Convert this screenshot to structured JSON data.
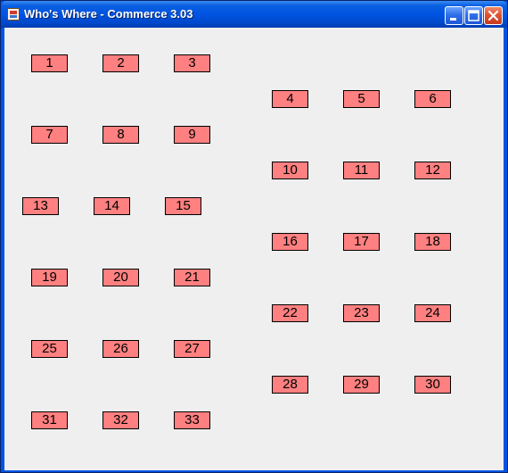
{
  "window": {
    "title": "Who's Where - Commerce 3.03"
  },
  "icons": {
    "app": "java-cup-icon",
    "minimize": "minimize-icon",
    "maximize": "maximize-icon",
    "close": "close-icon"
  },
  "colors": {
    "cell_fill": "#ff8080",
    "cell_border": "#000000",
    "client_bg": "#efefef",
    "titlebar": "#0054e3"
  },
  "cells": [
    "1",
    "2",
    "3",
    "4",
    "5",
    "6",
    "7",
    "8",
    "9",
    "10",
    "11",
    "12",
    "13",
    "14",
    "15",
    "16",
    "17",
    "18",
    "19",
    "20",
    "21",
    "22",
    "23",
    "24",
    "25",
    "26",
    "27",
    "28",
    "29",
    "30",
    "31",
    "32",
    "33"
  ]
}
